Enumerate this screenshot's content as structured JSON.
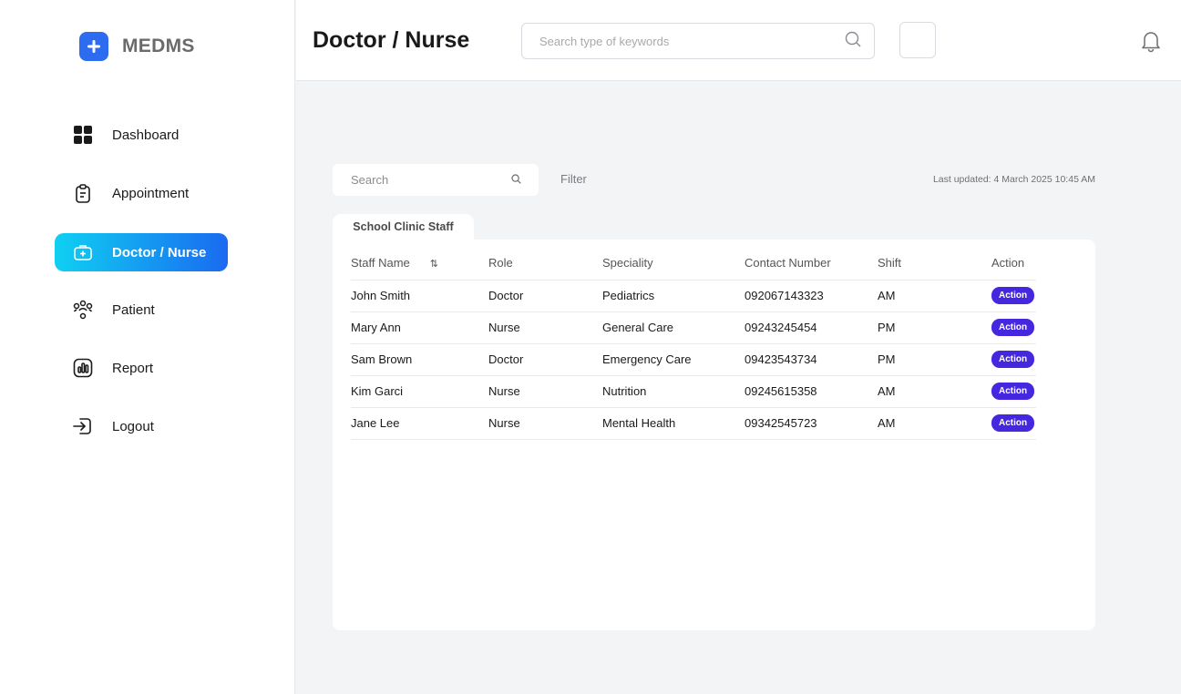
{
  "brand": {
    "name": "MEDMS"
  },
  "sidebar": {
    "items": [
      {
        "label": "Dashboard",
        "icon": "grid-icon",
        "active": false
      },
      {
        "label": "Appointment",
        "icon": "clipboard-icon",
        "active": false
      },
      {
        "label": "Doctor / Nurse",
        "icon": "medkit-icon",
        "active": true
      },
      {
        "label": "Patient",
        "icon": "people-icon",
        "active": false
      },
      {
        "label": "Report",
        "icon": "chart-icon",
        "active": false
      },
      {
        "label": "Logout",
        "icon": "logout-icon",
        "active": false
      }
    ]
  },
  "header": {
    "title": "Doctor / Nurse",
    "search_placeholder": "Search type of keywords"
  },
  "toolbar": {
    "search_placeholder": "Search",
    "filter_label": "Filter",
    "last_updated": "Last updated: 4 March 2025 10:45 AM"
  },
  "table": {
    "tab_label": "School Clinic Staff",
    "columns": [
      "Staff Name",
      "Role",
      "Speciality",
      "Contact Number",
      "Shift",
      "Action"
    ],
    "rows": [
      {
        "name": "John Smith",
        "role": "Doctor",
        "speciality": "Pediatrics",
        "contact": "092067143323",
        "shift": "AM",
        "action": "Action"
      },
      {
        "name": "Mary Ann",
        "role": "Nurse",
        "speciality": "General Care",
        "contact": "09243245454",
        "shift": "PM",
        "action": "Action"
      },
      {
        "name": "Sam Brown",
        "role": "Doctor",
        "speciality": "Emergency Care",
        "contact": "09423543734",
        "shift": "PM",
        "action": "Action"
      },
      {
        "name": "Kim Garci",
        "role": "Nurse",
        "speciality": "Nutrition",
        "contact": "09245615358",
        "shift": "AM",
        "action": "Action"
      },
      {
        "name": "Jane Lee",
        "role": "Nurse",
        "speciality": "Mental Health",
        "contact": "09342545723",
        "shift": "AM",
        "action": "Action"
      }
    ]
  },
  "colors": {
    "brand": "#2d6cf0",
    "active_gradient_start": "#0fd0f2",
    "active_gradient_end": "#1a6af0",
    "action_button": "#4527e0"
  }
}
